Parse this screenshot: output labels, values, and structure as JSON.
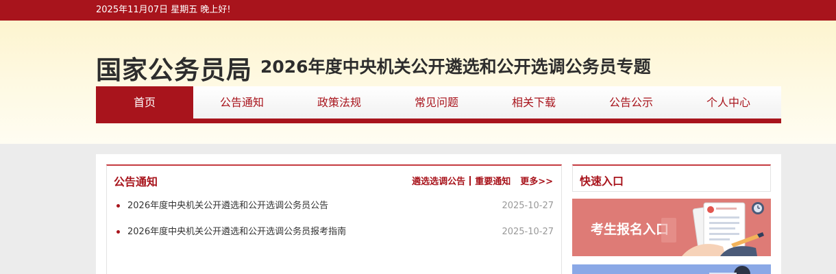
{
  "topbar": {
    "date_text": "2025年11月07日  星期五  晚上好!"
  },
  "header": {
    "site_name": "国家公务员局",
    "subtitle": "2026年度中央机关公开遴选和公开选调公务员专题"
  },
  "nav": {
    "items": [
      {
        "label": "首页",
        "active": true
      },
      {
        "label": "公告通知"
      },
      {
        "label": "政策法规"
      },
      {
        "label": "常见问题"
      },
      {
        "label": "相关下载"
      },
      {
        "label": "公告公示"
      },
      {
        "label": "个人中心"
      }
    ]
  },
  "notice": {
    "title": "公告通知",
    "links": {
      "announcement": "遴选选调公告",
      "important": "重要通知",
      "more": "更多>>"
    },
    "items": [
      {
        "title": "2026年度中央机关公开遴选和公开选调公务员公告",
        "date": "2025-10-27"
      },
      {
        "title": "2026年度中央机关公开遴选和公开选调公务员报考指南",
        "date": "2025-10-27"
      }
    ]
  },
  "quick": {
    "title": "快速入口",
    "banner_label": "考生报名入口"
  },
  "colors": {
    "brand_red": "#a8141c",
    "banner_pink": "#de7b76",
    "banner_blue": "#8aa8e6"
  }
}
